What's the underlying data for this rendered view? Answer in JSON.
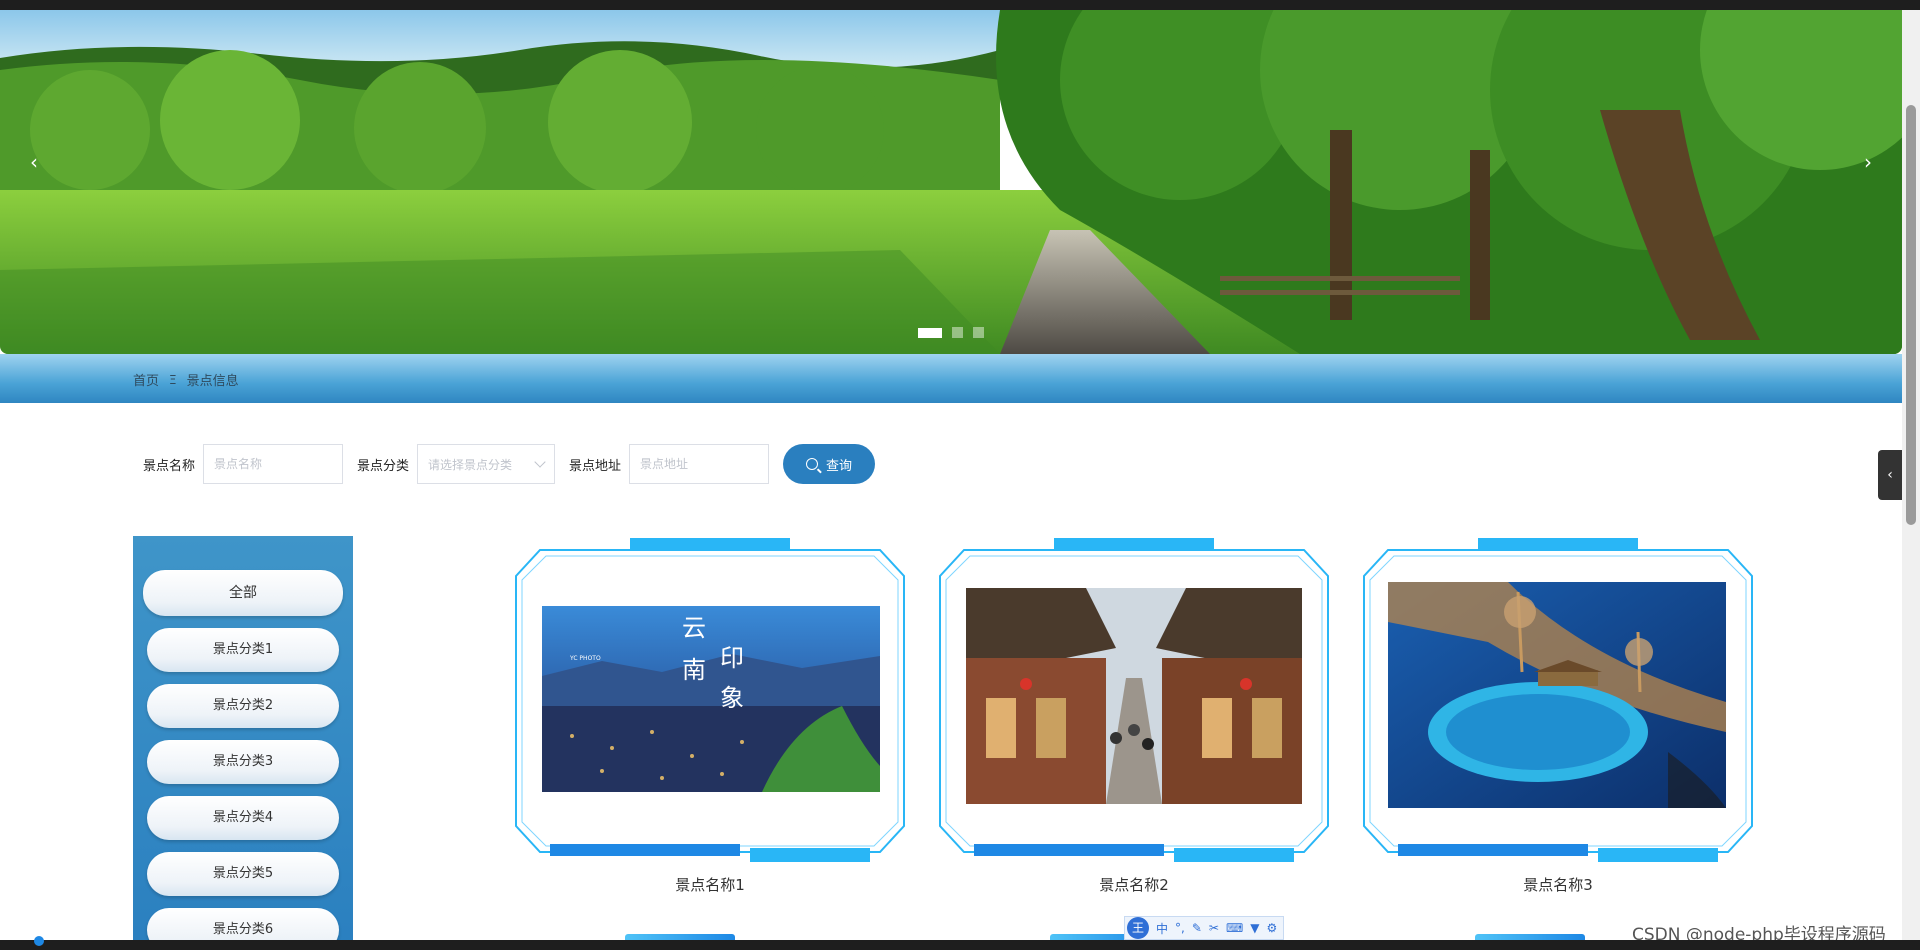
{
  "breadcrumb": {
    "home": "首页",
    "separator": "Ξ",
    "current": "景点信息"
  },
  "banner": {
    "prev_icon": "chevron-left-icon",
    "next_icon": "chevron-right-icon",
    "slides": 3,
    "active_slide": 1
  },
  "search": {
    "name_label": "景点名称",
    "name_placeholder": "景点名称",
    "category_label": "景点分类",
    "category_placeholder": "请选择景点分类",
    "address_label": "景点地址",
    "address_placeholder": "景点地址",
    "button_label": "查询"
  },
  "categories": [
    "全部",
    "景点分类1",
    "景点分类2",
    "景点分类3",
    "景点分类4",
    "景点分类5",
    "景点分类6"
  ],
  "cards": [
    {
      "title": "景点名称1",
      "photo_text": [
        "云",
        "南",
        "印",
        "象"
      ],
      "photo_caption": "YC PHOTO"
    },
    {
      "title": "景点名称2"
    },
    {
      "title": "景点名称3"
    }
  ],
  "ime": {
    "badge": "王",
    "mode": "中",
    "icons": [
      "punctuation-icon",
      "pen-icon",
      "scissors-icon",
      "keyboard-icon",
      "shirt-icon",
      "gear-icon"
    ]
  },
  "watermark": "CSDN @node-php毕设程序源码",
  "colors": {
    "accent": "#2a7fbf",
    "band": "#4aa3d6",
    "frame": "#29b6f6"
  }
}
